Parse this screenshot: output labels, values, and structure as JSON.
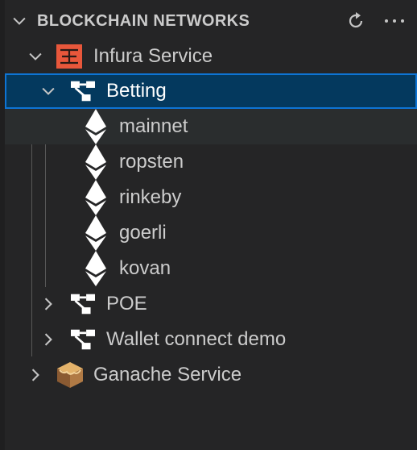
{
  "panel": {
    "title": "BLOCKCHAIN NETWORKS",
    "actions": {
      "refresh_icon": "refresh-icon",
      "more_icon": "more-actions-icon"
    }
  },
  "tree": {
    "infura": {
      "label": "Infura Service",
      "icon": "infura-logo-icon",
      "expanded": true,
      "projects": [
        {
          "label": "Betting",
          "expanded": true,
          "selected": true,
          "networks": [
            "mainnet",
            "ropsten",
            "rinkeby",
            "goerli",
            "kovan"
          ]
        },
        {
          "label": "POE",
          "expanded": false
        },
        {
          "label": "Wallet connect demo",
          "expanded": false
        }
      ]
    },
    "ganache": {
      "label": "Ganache Service",
      "icon": "ganache-logo-icon",
      "expanded": false
    }
  },
  "colors": {
    "background": "#252526",
    "selection_background": "#04395e",
    "selection_border": "#0e74d4",
    "text": "#cccccc",
    "infura_brand": "#e8573b",
    "ganache_brand": "#b07a45"
  }
}
